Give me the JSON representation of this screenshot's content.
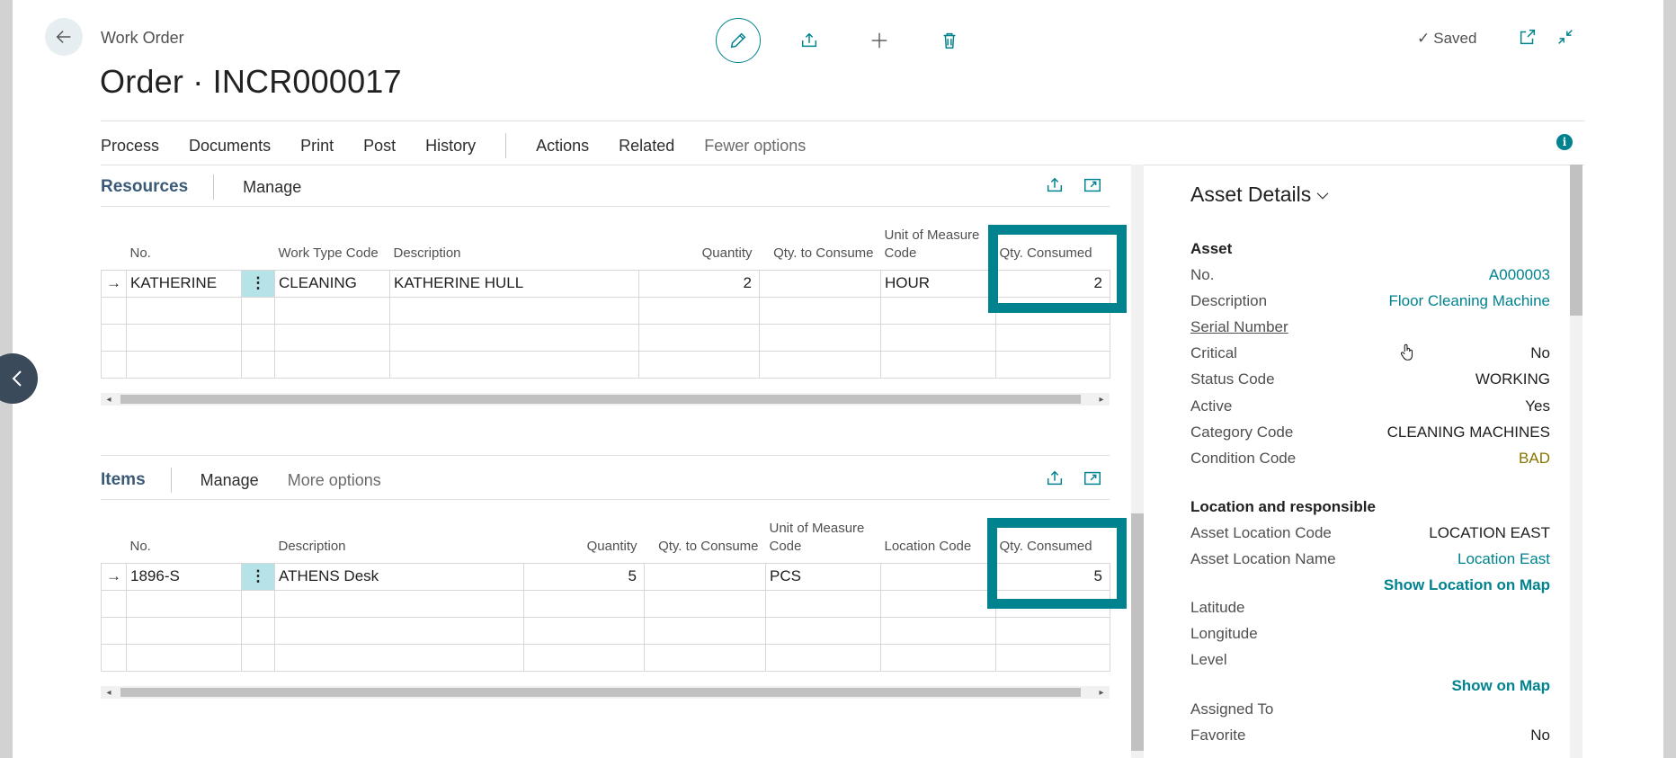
{
  "header": {
    "breadcrumb": "Work Order",
    "title": "Order · INCR000017",
    "saved_label": "Saved"
  },
  "menu": {
    "items": [
      "Process",
      "Documents",
      "Print",
      "Post",
      "History"
    ],
    "secondary": [
      "Actions",
      "Related"
    ],
    "fewer": "Fewer options"
  },
  "resources": {
    "title": "Resources",
    "manage": "Manage",
    "columns": {
      "no": "No.",
      "work_type": "Work Type Code",
      "description": "Description",
      "quantity": "Quantity",
      "qty_to_consume": "Qty. to Consume",
      "uom": "Unit of Measure Code",
      "qty_consumed": "Qty. Consumed"
    },
    "row": {
      "no": "KATHERINE",
      "work_type": "CLEANING",
      "description": "KATHERINE HULL",
      "quantity": "2",
      "qty_to_consume": "",
      "uom": "HOUR",
      "qty_consumed": "2"
    }
  },
  "items": {
    "title": "Items",
    "manage": "Manage",
    "more": "More options",
    "columns": {
      "no": "No.",
      "description": "Description",
      "quantity": "Quantity",
      "qty_to_consume": "Qty. to Consume",
      "uom": "Unit of Measure Code",
      "location": "Location Code",
      "qty_consumed": "Qty. Consumed"
    },
    "row": {
      "no": "1896-S",
      "description": "ATHENS Desk",
      "quantity": "5",
      "qty_to_consume": "",
      "uom": "PCS",
      "location": "",
      "qty_consumed": "5"
    }
  },
  "asset_details": {
    "title": "Asset Details",
    "asset_group": "Asset",
    "no_label": "No.",
    "no_value": "A000003",
    "desc_label": "Description",
    "desc_value": "Floor Cleaning Machine",
    "serial_label": "Serial Number",
    "critical_label": "Critical",
    "critical_value": "No",
    "status_label": "Status Code",
    "status_value": "WORKING",
    "active_label": "Active",
    "active_value": "Yes",
    "category_label": "Category Code",
    "category_value": "CLEANING MACHINES",
    "condition_label": "Condition Code",
    "condition_value": "BAD",
    "location_group": "Location and responsible",
    "loc_code_label": "Asset Location Code",
    "loc_code_value": "LOCATION EAST",
    "loc_name_label": "Asset Location Name",
    "loc_name_value": "Location East",
    "show_location_map": "Show Location on Map",
    "latitude_label": "Latitude",
    "longitude_label": "Longitude",
    "level_label": "Level",
    "show_on_map": "Show on Map",
    "assigned_label": "Assigned To",
    "favorite_label": "Favorite",
    "favorite_value": "No"
  },
  "colors": {
    "accent": "#00838f",
    "section_title": "#3a5a78",
    "warning": "#8a7400"
  }
}
